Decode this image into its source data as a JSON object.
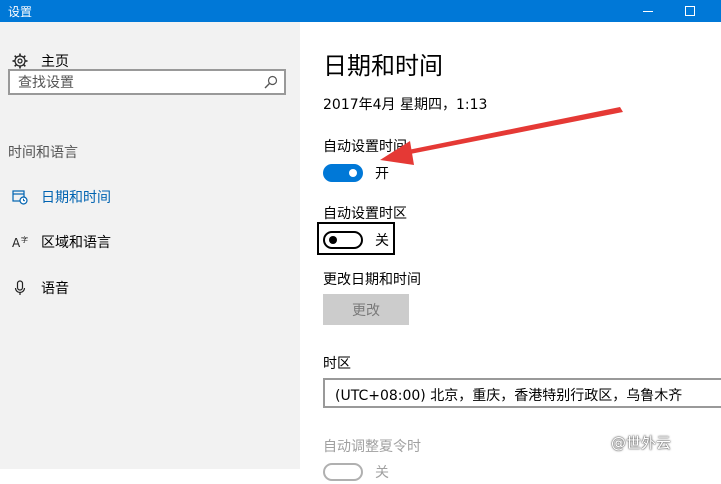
{
  "window": {
    "title": "设置"
  },
  "sidebar": {
    "home_label": "主页",
    "search_placeholder": "查找设置",
    "section_label": "时间和语言",
    "items": [
      {
        "label": "日期和时间",
        "icon": "calendar-clock-icon",
        "active": true
      },
      {
        "label": "区域和语言",
        "icon": "language-icon",
        "active": false
      },
      {
        "label": "语音",
        "icon": "microphone-icon",
        "active": false
      }
    ]
  },
  "main": {
    "title": "日期和时间",
    "current_datetime": "2017年4月 星期四，1:13",
    "auto_time": {
      "label": "自动设置时间",
      "state_text": "开",
      "on": true
    },
    "auto_timezone": {
      "label": "自动设置时区",
      "state_text": "关",
      "on": false
    },
    "change": {
      "label": "更改日期和时间",
      "button_label": "更改"
    },
    "timezone": {
      "label": "时区",
      "value": "(UTC+08:00) 北京，重庆，香港特别行政区，乌鲁木齐"
    },
    "dst": {
      "label": "自动调整夏令时",
      "state_text": "关"
    }
  },
  "watermark": "@世外云",
  "colors": {
    "accent": "#0078d7",
    "annotation_arrow": "#e53935",
    "sidebar_bg": "#f2f2f2"
  }
}
